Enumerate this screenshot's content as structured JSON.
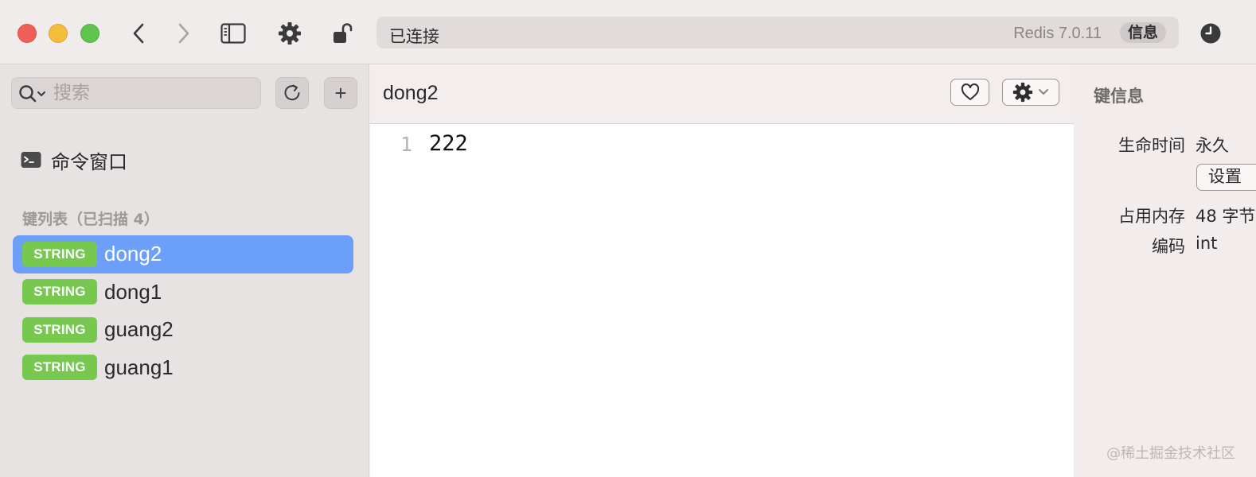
{
  "colors": {
    "accent_selected": "#6b9ffa",
    "string_badge": "#76c84f",
    "traffic_red": "#ee5f59",
    "traffic_yellow": "#f5bd3b",
    "traffic_green": "#60c54c"
  },
  "toolbar": {
    "icons": [
      "back-icon",
      "forward-icon",
      "sidebar-toggle-icon",
      "gear-icon",
      "unlock-icon",
      "clock-icon"
    ],
    "address": {
      "status": "已连接",
      "version": "Redis 7.0.11",
      "info_label": "信息"
    }
  },
  "sidebar": {
    "search_placeholder": "搜索",
    "add_label": "+",
    "command_window": "命令窗口",
    "key_list_title": "键列表（已扫描 4）",
    "keys": [
      {
        "type": "STRING",
        "name": "dong2",
        "selected": true
      },
      {
        "type": "STRING",
        "name": "dong1",
        "selected": false
      },
      {
        "type": "STRING",
        "name": "guang2",
        "selected": false
      },
      {
        "type": "STRING",
        "name": "guang1",
        "selected": false
      }
    ]
  },
  "main": {
    "title": "dong2",
    "line_number": "1",
    "value": "222"
  },
  "info": {
    "title": "键信息",
    "ttl_label": "生命时间",
    "ttl_value": "永久",
    "set_button": "设置",
    "memory_label": "占用内存",
    "memory_value": "48 字节",
    "encoding_label": "编码",
    "encoding_value": "int"
  },
  "watermark": "@稀土掘金技术社区"
}
